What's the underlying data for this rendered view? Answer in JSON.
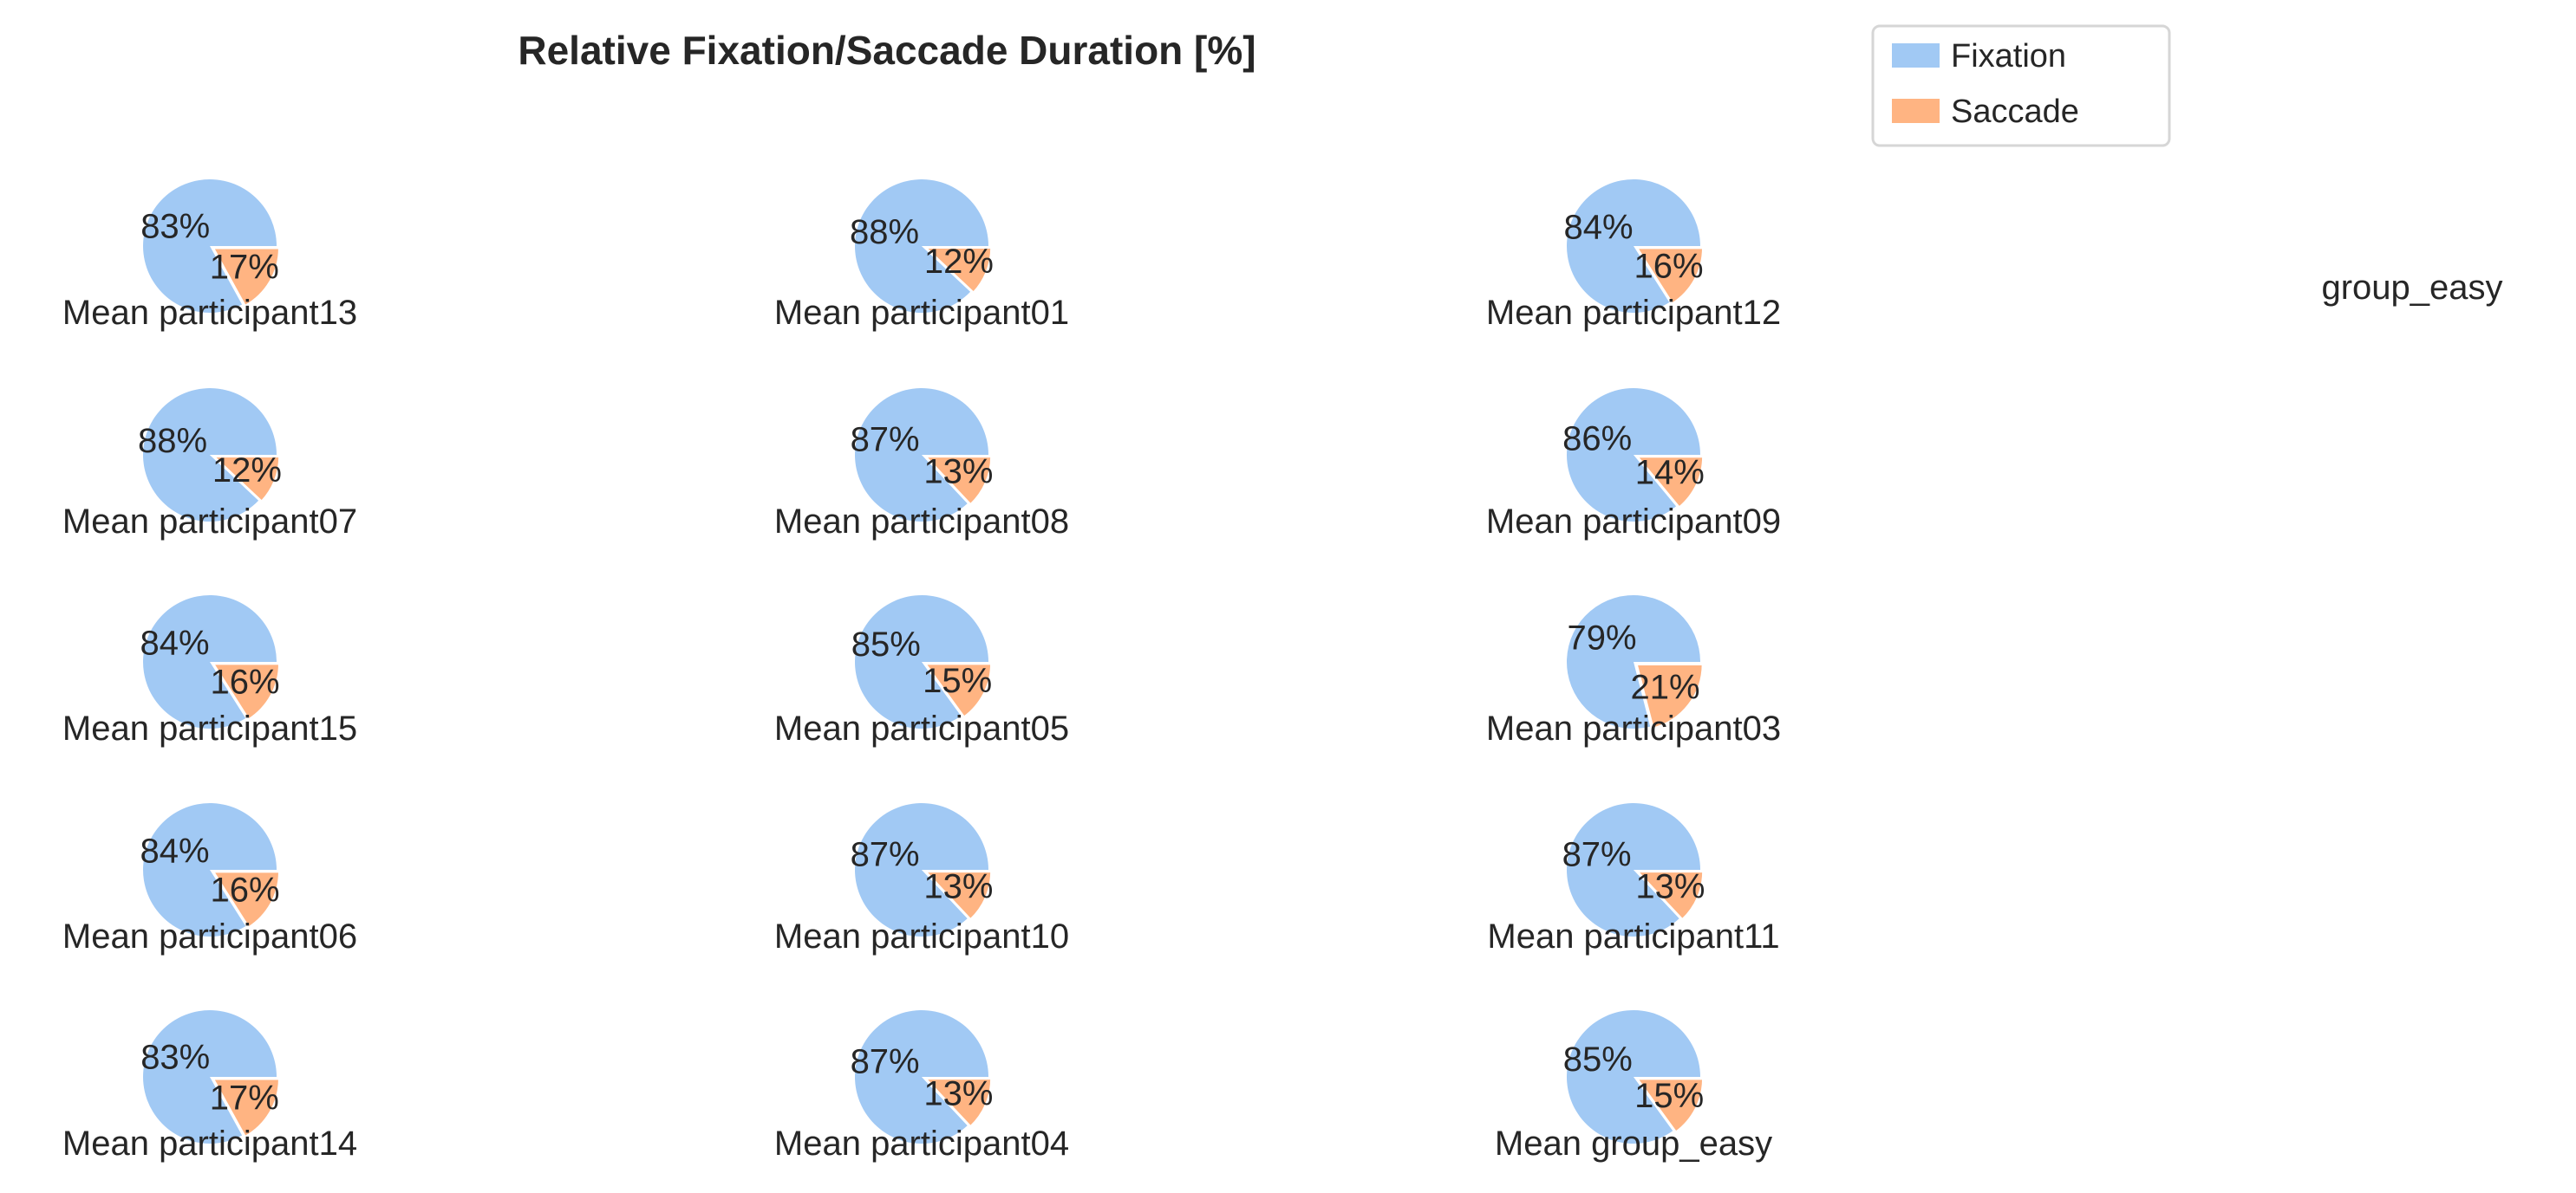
{
  "chart_data": {
    "type": "pie",
    "title": "Relative Fixation/Saccade Duration [%]",
    "group_label": "group_easy",
    "legend": {
      "placement": "top-right",
      "entries": [
        "Fixation",
        "Saccade"
      ]
    },
    "colors": {
      "Fixation": "#a1c9f4",
      "Saccade": "#ffb482",
      "text": "#262626"
    },
    "pies": [
      {
        "label": "Mean participant13",
        "values": [
          83,
          17
        ],
        "labels": [
          "83%",
          "17%"
        ]
      },
      {
        "label": "Mean participant01",
        "values": [
          88,
          12
        ],
        "labels": [
          "88%",
          "12%"
        ]
      },
      {
        "label": "Mean participant12",
        "values": [
          84,
          16
        ],
        "labels": [
          "84%",
          "16%"
        ]
      },
      {
        "label": "Mean participant07",
        "values": [
          88,
          12
        ],
        "labels": [
          "88%",
          "12%"
        ]
      },
      {
        "label": "Mean participant08",
        "values": [
          87,
          13
        ],
        "labels": [
          "87%",
          "13%"
        ]
      },
      {
        "label": "Mean participant09",
        "values": [
          86,
          14
        ],
        "labels": [
          "86%",
          "14%"
        ]
      },
      {
        "label": "Mean participant15",
        "values": [
          84,
          16
        ],
        "labels": [
          "84%",
          "16%"
        ]
      },
      {
        "label": "Mean participant05",
        "values": [
          85,
          15
        ],
        "labels": [
          "85%",
          "15%"
        ]
      },
      {
        "label": "Mean participant03",
        "values": [
          79,
          21
        ],
        "labels": [
          "79%",
          "21%"
        ]
      },
      {
        "label": "Mean participant06",
        "values": [
          84,
          16
        ],
        "labels": [
          "84%",
          "16%"
        ]
      },
      {
        "label": "Mean participant10",
        "values": [
          87,
          13
        ],
        "labels": [
          "87%",
          "13%"
        ]
      },
      {
        "label": "Mean participant11",
        "values": [
          87,
          13
        ],
        "labels": [
          "87%",
          "13%"
        ]
      },
      {
        "label": "Mean participant14",
        "values": [
          83,
          17
        ],
        "labels": [
          "83%",
          "17%"
        ]
      },
      {
        "label": "Mean participant04",
        "values": [
          87,
          13
        ],
        "labels": [
          "87%",
          "13%"
        ]
      },
      {
        "label": "Mean group_easy",
        "values": [
          85,
          15
        ],
        "labels": [
          "85%",
          "15%"
        ]
      }
    ]
  }
}
